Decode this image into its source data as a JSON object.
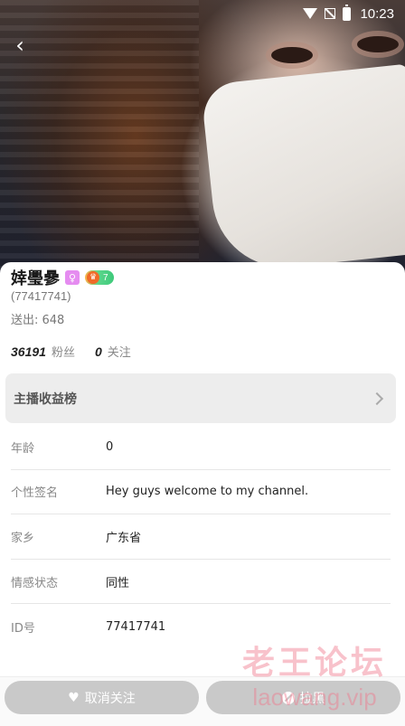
{
  "status_bar": {
    "time": "10:23",
    "icons": [
      "wifi-icon",
      "signal-icon",
      "battery-icon"
    ]
  },
  "header": {
    "back_icon": "chevron-left-icon",
    "back_glyph": "‹"
  },
  "profile": {
    "name": "婞璺曑",
    "gender_glyph": "♀",
    "level": "7",
    "user_id_display": "(77417741)",
    "sent_label": "送出: 648",
    "fans_count": "36191",
    "fans_label": "粉丝",
    "following_count": "0",
    "following_label": "关注"
  },
  "earnings": {
    "label": "主播收益榜"
  },
  "info": [
    {
      "label": "年龄",
      "value": "0"
    },
    {
      "label": "个性签名",
      "value": "Hey guys welcome to my channel."
    },
    {
      "label": "家乡",
      "value": "广东省"
    },
    {
      "label": "情感状态",
      "value": "同性"
    },
    {
      "label": "ID号",
      "value": "77417741"
    }
  ],
  "actions": {
    "unfollow_label": "取消关注",
    "block_label": "拉黑"
  },
  "watermark": {
    "cn": "老王论坛",
    "en": "laowang.vip"
  },
  "colors": {
    "button_bg": "#c9c9c9",
    "gender_badge": "#e58cf0",
    "level_badge_start": "#ffb24a",
    "level_badge_end": "#3ec97a",
    "watermark": "#f0788c"
  }
}
